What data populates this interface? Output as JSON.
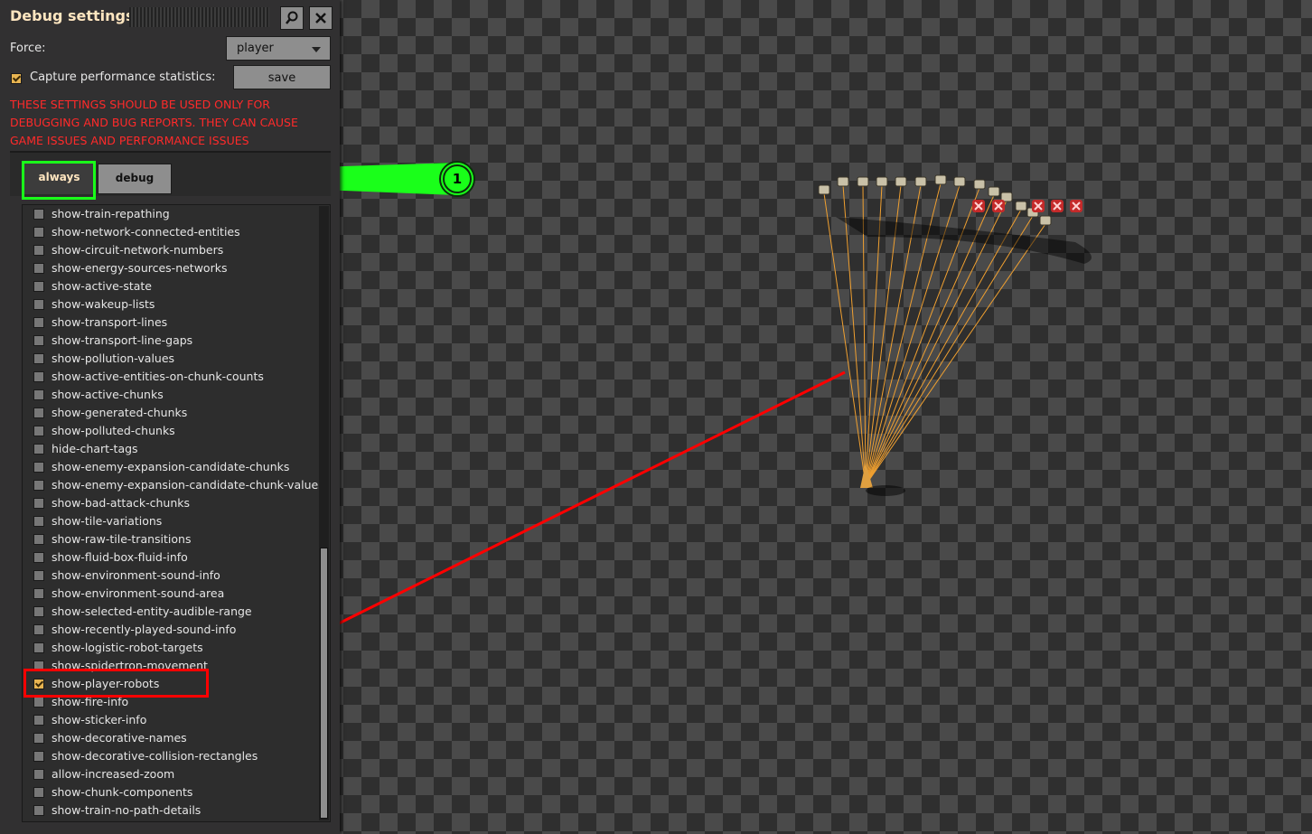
{
  "panel": {
    "title": "Debug settings",
    "search_icon": "magnifier-icon",
    "close_icon": "close-icon",
    "force_label": "Force:",
    "force_value": "player",
    "capture_label": "Capture performance statistics:",
    "capture_checked": true,
    "save_label": "save",
    "warning": "THESE SETTINGS SHOULD BE USED ONLY FOR DEBUGGING AND BUG REPORTS. THEY CAN CAUSE GAME ISSUES AND PERFORMANCE ISSUES"
  },
  "tabs": [
    {
      "label": "always",
      "active": true
    },
    {
      "label": "debug",
      "active": false
    }
  ],
  "options": [
    {
      "label": "show-train-repathing",
      "checked": false
    },
    {
      "label": "show-network-connected-entities",
      "checked": false
    },
    {
      "label": "show-circuit-network-numbers",
      "checked": false
    },
    {
      "label": "show-energy-sources-networks",
      "checked": false
    },
    {
      "label": "show-active-state",
      "checked": false
    },
    {
      "label": "show-wakeup-lists",
      "checked": false
    },
    {
      "label": "show-transport-lines",
      "checked": false
    },
    {
      "label": "show-transport-line-gaps",
      "checked": false
    },
    {
      "label": "show-pollution-values",
      "checked": false
    },
    {
      "label": "show-active-entities-on-chunk-counts",
      "checked": false
    },
    {
      "label": "show-active-chunks",
      "checked": false
    },
    {
      "label": "show-generated-chunks",
      "checked": false
    },
    {
      "label": "show-polluted-chunks",
      "checked": false
    },
    {
      "label": "hide-chart-tags",
      "checked": false
    },
    {
      "label": "show-enemy-expansion-candidate-chunks",
      "checked": false
    },
    {
      "label": "show-enemy-expansion-candidate-chunk-values",
      "checked": false
    },
    {
      "label": "show-bad-attack-chunks",
      "checked": false
    },
    {
      "label": "show-tile-variations",
      "checked": false
    },
    {
      "label": "show-raw-tile-transitions",
      "checked": false
    },
    {
      "label": "show-fluid-box-fluid-info",
      "checked": false
    },
    {
      "label": "show-environment-sound-info",
      "checked": false
    },
    {
      "label": "show-environment-sound-area",
      "checked": false
    },
    {
      "label": "show-selected-entity-audible-range",
      "checked": false
    },
    {
      "label": "show-recently-played-sound-info",
      "checked": false
    },
    {
      "label": "show-logistic-robot-targets",
      "checked": false
    },
    {
      "label": "show-spidertron-movement",
      "checked": false
    },
    {
      "label": "show-player-robots",
      "checked": true
    },
    {
      "label": "show-fire-info",
      "checked": false
    },
    {
      "label": "show-sticker-info",
      "checked": false
    },
    {
      "label": "show-decorative-names",
      "checked": false
    },
    {
      "label": "show-decorative-collision-rectangles",
      "checked": false
    },
    {
      "label": "allow-increased-zoom",
      "checked": false
    },
    {
      "label": "show-chunk-components",
      "checked": false
    },
    {
      "label": "show-train-no-path-details",
      "checked": false
    }
  ],
  "annotation": {
    "badge_number": "1",
    "green": "#1aff1a",
    "red": "#ff0000"
  },
  "colors": {
    "accent_checkbox": "#e8b451",
    "title_text": "#ffe6c0",
    "warning_text": "#ff2a2a",
    "robot_line": "#f0a030"
  }
}
